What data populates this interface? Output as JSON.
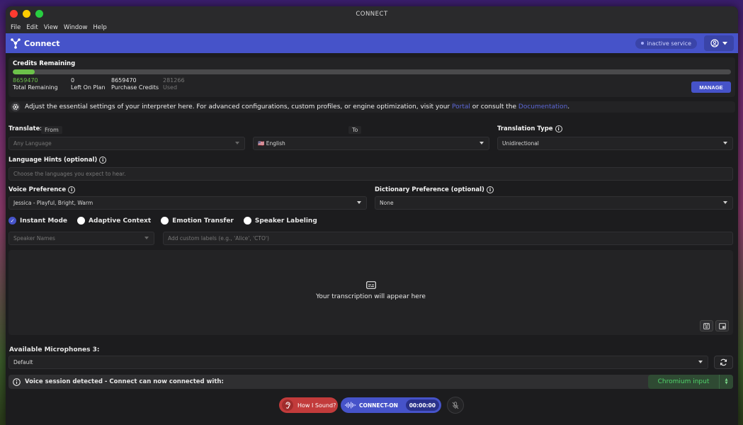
{
  "window": {
    "title": "CONNECT"
  },
  "menu": [
    "File",
    "Edit",
    "View",
    "Window",
    "Help"
  ],
  "appbar": {
    "brand": "Connect",
    "status": "inactive service"
  },
  "credits": {
    "title": "Credits Remaining",
    "used_fraction": 0.031,
    "stats": [
      {
        "value": "8659470",
        "label": "Total Remaining"
      },
      {
        "value": "0",
        "label": "Left On Plan"
      },
      {
        "value": "8659470",
        "label": "Purchase Credits"
      },
      {
        "value": "281266",
        "label": "Used"
      }
    ],
    "manage_label": "MANAGE"
  },
  "notice": {
    "text": "Adjust the essential settings of your interpreter here. For advanced configurations, custom profiles, or engine optimization, visit your",
    "portal": "Portal",
    "middle": "or consult the",
    "docs": "Documentation",
    "end": "."
  },
  "translate": {
    "label": "Translate:",
    "from_chip": "From",
    "to_chip": "To",
    "from_placeholder": "Any Language",
    "to_value": "🇺🇸 English",
    "type_label": "Translation Type",
    "type_value": "Unidirectional"
  },
  "hints": {
    "label": "Language Hints (optional)",
    "placeholder": "Choose the languages you expect to hear."
  },
  "voice": {
    "label": "Voice Preference",
    "value": "Jessica - Playful, Bright, Warm"
  },
  "dictionary": {
    "label": "Dictionary Preference (optional)",
    "value": "None"
  },
  "options": [
    {
      "label": "Instant Mode",
      "checked": true
    },
    {
      "label": "Adaptive Context",
      "checked": false
    },
    {
      "label": "Emotion Transfer",
      "checked": false
    },
    {
      "label": "Speaker Labeling",
      "checked": false
    }
  ],
  "speaker": {
    "names_placeholder": "Speaker Names",
    "labels_placeholder": "Add custom labels (e.g., 'Alice', 'CTO')"
  },
  "transcript": {
    "placeholder": "Your transcription will appear here"
  },
  "microphones": {
    "label": "Available Microphones 3:",
    "value": "Default"
  },
  "voice_session": {
    "text": "Voice session detected - Connect can now connected with:",
    "source": "Chromium input"
  },
  "bottom": {
    "sound_label": "How I Sound?",
    "connect_label": "CONNECT-ON",
    "timer": "00:00:00"
  },
  "colors": {
    "accent": "#4653c9",
    "credit_green": "#6cc24a",
    "danger": "#c23b3b"
  }
}
